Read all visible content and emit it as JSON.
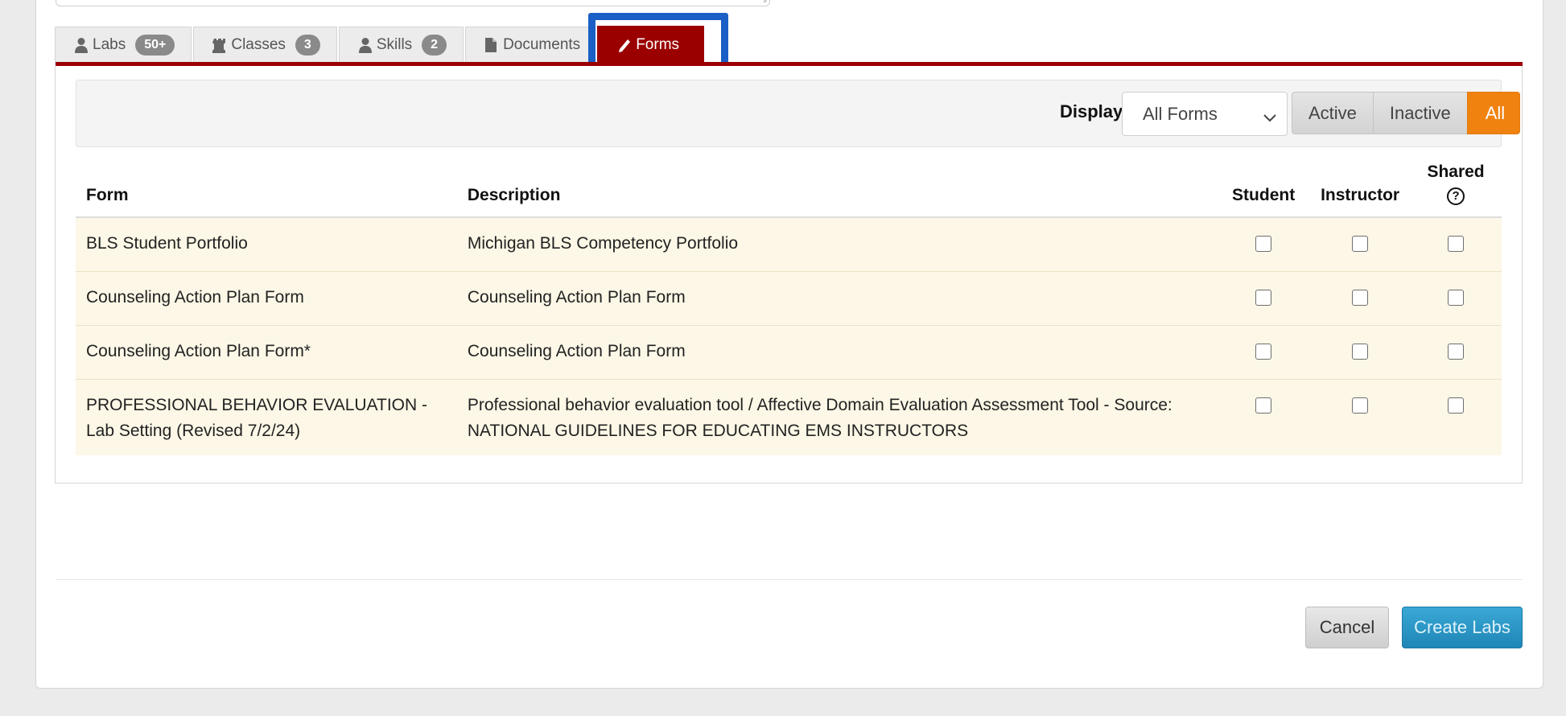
{
  "tabs": [
    {
      "label": "Labs",
      "badge": "50+",
      "icon": "person-icon"
    },
    {
      "label": "Classes",
      "badge": "3",
      "icon": "chess-rook-icon"
    },
    {
      "label": "Skills",
      "badge": "2",
      "icon": "person-icon"
    },
    {
      "label": "Documents",
      "badge": "",
      "icon": "document-icon"
    },
    {
      "label": "Forms",
      "badge": "",
      "icon": "pencil-icon",
      "active": true
    }
  ],
  "filter": {
    "display_label": "Display",
    "select_value": "All Forms",
    "segments": [
      "Active",
      "Inactive",
      "All"
    ],
    "selected_segment": "All"
  },
  "table": {
    "headers": {
      "form": "Form",
      "description": "Description",
      "student": "Student",
      "instructor": "Instructor",
      "shared": "Shared",
      "shared_help": "?"
    },
    "rows": [
      {
        "form": "BLS Student Portfolio",
        "description": "Michigan BLS Competency Portfolio"
      },
      {
        "form": "Counseling Action Plan Form",
        "description": "Counseling Action Plan Form"
      },
      {
        "form": "Counseling Action Plan Form*",
        "description": "Counseling Action Plan Form"
      },
      {
        "form": "PROFESSIONAL BEHAVIOR EVALUATION - Lab Setting (Revised 7/2/24)",
        "description": "Professional behavior evaluation tool / Affective Domain Evaluation Assessment Tool - Source: NATIONAL GUIDELINES FOR EDUCATING EMS INSTRUCTORS"
      }
    ]
  },
  "footer": {
    "cancel_label": "Cancel",
    "create_label": "Create Labs"
  },
  "colors": {
    "active_tab": "#9b0000",
    "highlight": "#1a5fc5",
    "selected_segment": "#f0820f",
    "row_bg": "#fcf7e6",
    "primary_button": "#2a96c6"
  }
}
